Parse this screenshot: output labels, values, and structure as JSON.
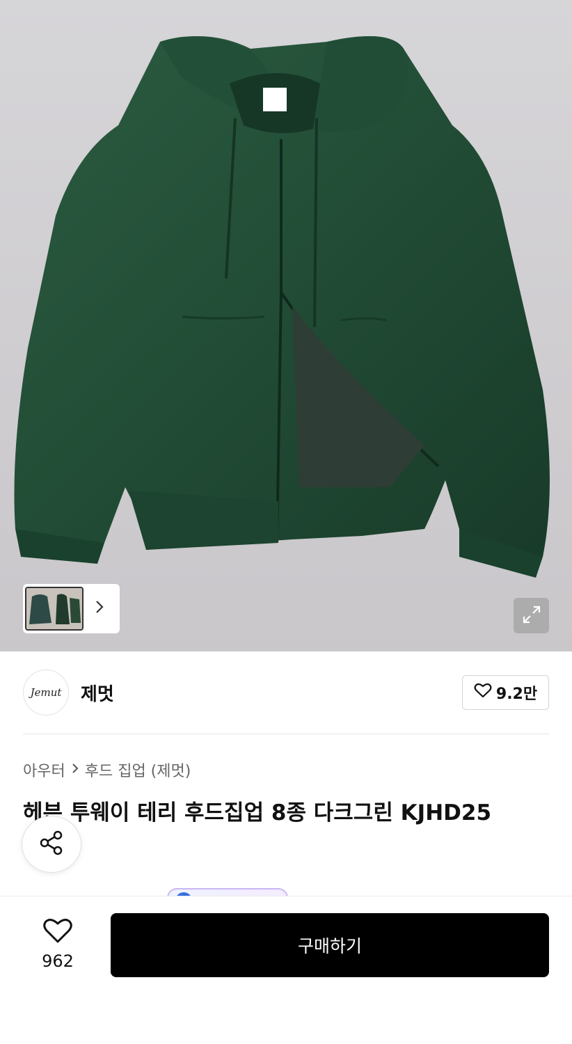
{
  "hero": {
    "image_alt": "dark green zip-up hoodie",
    "thumb_icon": "chevron-right-icon",
    "expand_icon": "expand-icon"
  },
  "brand": {
    "logo_text": "Jemut",
    "name": "제멋",
    "like_icon": "heart-outline-icon",
    "like_count": "9.2만"
  },
  "breadcrumb": {
    "category": "아우터",
    "separator_icon": "chevron-right-icon",
    "subcategory": "후드 집업 (제멋)"
  },
  "product": {
    "title": "헤븐 투웨이 테리 후드집업 8종 다크그린 KJHD25"
  },
  "share": {
    "icon": "share-icon"
  },
  "bottom": {
    "wish_icon": "heart-outline-icon",
    "wish_count": "962",
    "buy_label": "구매하기"
  },
  "colors": {
    "hoodie": "#1f4a33",
    "button_bg": "#000000"
  }
}
